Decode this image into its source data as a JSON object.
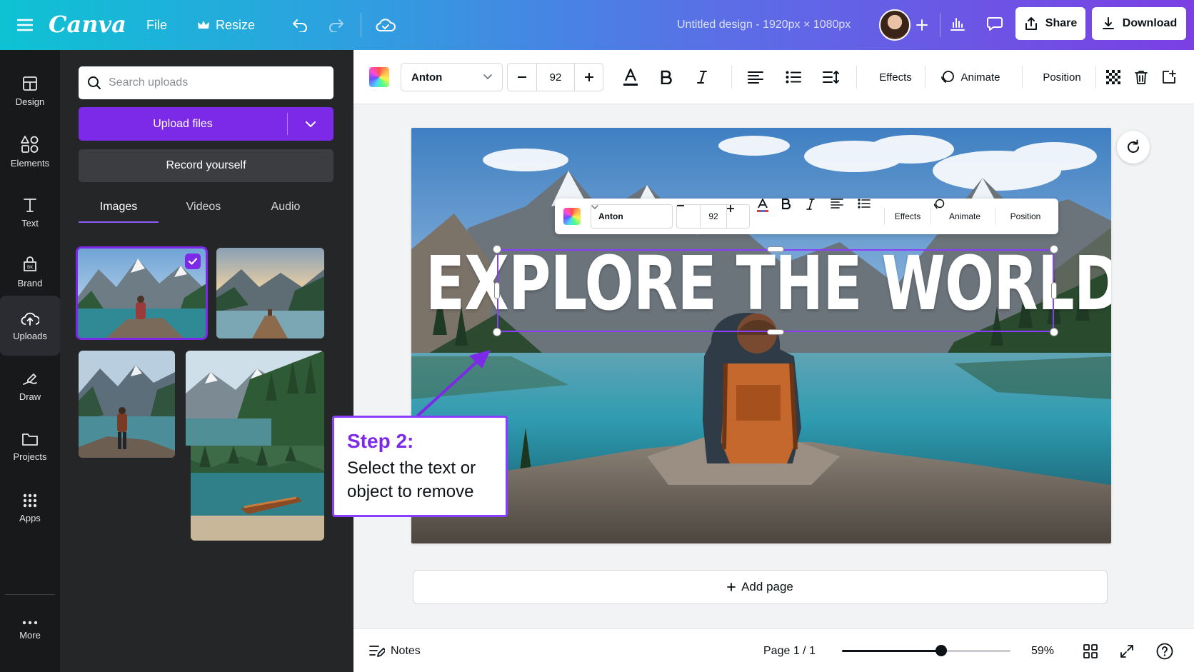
{
  "topbar": {
    "logo": "Canva",
    "file": "File",
    "resize": "Resize",
    "doc_title": "Untitled design - 1920px × 1080px",
    "share": "Share",
    "download": "Download"
  },
  "rail": {
    "items": [
      {
        "label": "Design",
        "icon": "design-icon"
      },
      {
        "label": "Elements",
        "icon": "elements-icon"
      },
      {
        "label": "Text",
        "icon": "text-icon"
      },
      {
        "label": "Brand",
        "icon": "brand-icon"
      },
      {
        "label": "Uploads",
        "icon": "cloud-upload-icon"
      },
      {
        "label": "Draw",
        "icon": "draw-icon"
      },
      {
        "label": "Projects",
        "icon": "folder-icon"
      },
      {
        "label": "Apps",
        "icon": "apps-grid-icon"
      },
      {
        "label": "More",
        "icon": "more-dots-icon"
      }
    ]
  },
  "panel": {
    "search_placeholder": "Search uploads",
    "upload_files": "Upload files",
    "record_yourself": "Record yourself",
    "tabs": [
      {
        "label": "Images"
      },
      {
        "label": "Videos"
      },
      {
        "label": "Audio"
      }
    ],
    "active_tab": "Images"
  },
  "toolbar": {
    "font": "Anton",
    "font_size": "92",
    "effects": "Effects",
    "animate": "Animate",
    "position": "Position"
  },
  "canvas": {
    "headline": "EXPLORE THE WORLD",
    "floating_toolbar": {
      "font": "Anton",
      "font_size": "92",
      "effects": "Effects",
      "animate": "Animate",
      "position": "Position"
    }
  },
  "callout": {
    "step": "Step 2:",
    "line1": "Select the text or",
    "line2": "object to remove"
  },
  "add_page": "Add page",
  "bottombar": {
    "notes": "Notes",
    "page": "Page 1 / 1",
    "zoom_level": "59%",
    "zoom_fraction": 0.59
  },
  "colors": {
    "accent": "#7d2ae8",
    "selection": "#8b3dff",
    "rail_bg": "#18191b",
    "panel_bg": "#252627"
  }
}
